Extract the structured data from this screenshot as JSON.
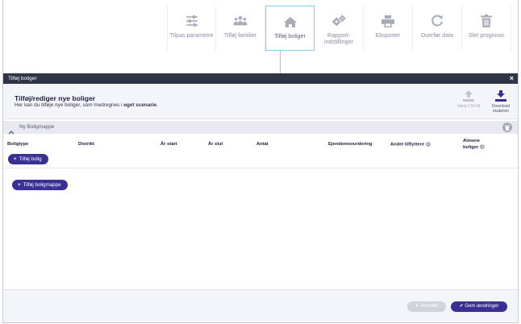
{
  "toolbar": {
    "items": [
      {
        "label": "Tilpas parametre",
        "icon": "sliders-icon"
      },
      {
        "label": "Tilføj familier",
        "icon": "family-icon"
      },
      {
        "label": "Tilføj boliger",
        "icon": "home-icon",
        "active": true
      },
      {
        "label": "Rapport-indstillinger",
        "line1": "Rapport-",
        "line2": "indstillinger",
        "icon": "gears-icon"
      },
      {
        "label": "Eksporter",
        "icon": "printer-icon"
      },
      {
        "label": "Overfør data",
        "icon": "refresh-icon"
      },
      {
        "label": "Slet prognose",
        "icon": "trash-icon"
      }
    ]
  },
  "panel": {
    "title": "Tilføj boliger",
    "close": "×"
  },
  "intro": {
    "heading": "Tilføj/rediger nye boliger",
    "text_prefix": "Her kan du tilføje nye boliger, som medregnes i ",
    "text_bold": "eget scenarie",
    "text_suffix": ".",
    "upload_label": "Vælg CSV-fil",
    "download_line1": "Download",
    "download_line2": "skabelon"
  },
  "section": {
    "title": "Ny Boligmappe"
  },
  "columns": {
    "boligtype": "Boligtype",
    "distrikt": "Distrikt",
    "aar_start": "År start",
    "aar_slut": "År slut",
    "antal": "Antal",
    "ejendom": "Ejendomsvurdering",
    "tilflyttere": "Andel tilflyttere",
    "almene1": "Almene",
    "almene2": "boliger"
  },
  "buttons": {
    "add_bolig": "Tilføj bolig",
    "add_mappe": "Tilføj boligmappe",
    "cancel": "Annuller",
    "save": "Gem ændringer"
  },
  "colors": {
    "primary": "#3a2f93",
    "header_bar": "#2e3547",
    "active_border": "#7fd3e6",
    "icon_grey": "#a9acb8"
  }
}
